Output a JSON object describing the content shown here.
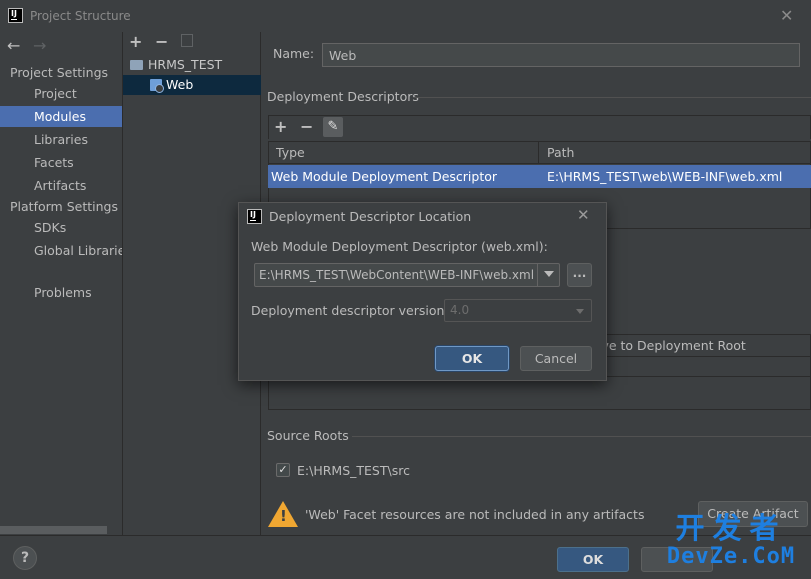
{
  "window": {
    "title": "Project Structure",
    "logo_text": "IJ",
    "close_glyph": "✕"
  },
  "nav": {
    "back_glyph": "←",
    "forward_glyph": "→",
    "project_settings_header": "Project Settings",
    "platform_settings_header": "Platform Settings",
    "items": [
      {
        "label": "Project"
      },
      {
        "label": "Modules",
        "selected": true
      },
      {
        "label": "Libraries"
      },
      {
        "label": "Facets"
      },
      {
        "label": "Artifacts"
      },
      {
        "label": "SDKs"
      },
      {
        "label": "Global Libraries"
      },
      {
        "label": "Problems"
      }
    ]
  },
  "tree": {
    "add_glyph": "+",
    "remove_glyph": "−",
    "root_label": "HRMS_TEST",
    "child_label": "Web",
    "icons": [
      "folder-icon",
      "web-facet-icon",
      "copy-icon"
    ]
  },
  "facet": {
    "name_label": "Name:",
    "name_value": "Web",
    "deployment_descriptors_title": "Deployment Descriptors",
    "dd_add_glyph": "+",
    "dd_remove_glyph": "−",
    "dd_edit_glyph": "✎",
    "dd_columns": [
      "Type",
      "Path"
    ],
    "dd_rows": [
      {
        "type": "Web Module Deployment Descriptor",
        "path": "E:\\HRMS_TEST\\web\\WEB-INF\\web.xml"
      }
    ],
    "webroot_partial_header": "ive to Deployment Root",
    "source_roots_title": "Source Roots",
    "source_root_checked": true,
    "source_root_check_glyph": "✓",
    "source_root_path": "E:\\HRMS_TEST\\src",
    "warning_text": "'Web' Facet resources are not included in any artifacts",
    "warning_glyph": "!",
    "create_artifact_label": "Create Artifact"
  },
  "footer": {
    "help_glyph": "?",
    "ok_label": "OK"
  },
  "watermark": {
    "line1": "开发者",
    "line2": "DevZe.CoM"
  },
  "dialog": {
    "logo_text": "IJ",
    "title": "Deployment Descriptor Location",
    "close_glyph": "✕",
    "file_label": "Web Module Deployment Descriptor (web.xml):",
    "file_value": "E:\\HRMS_TEST\\WebContent\\WEB-INF\\web.xml",
    "browse_label": "...",
    "version_label": "Deployment descriptor version",
    "version_value": "4.0",
    "ok_label": "OK",
    "cancel_label": "Cancel"
  },
  "colors": {
    "background": "#3c3f41",
    "selection": "#4b6eaf",
    "tree_selection": "#0d293e",
    "default_button": "#365880",
    "warning": "#f0a732",
    "watermark": "#1e7fe0"
  }
}
